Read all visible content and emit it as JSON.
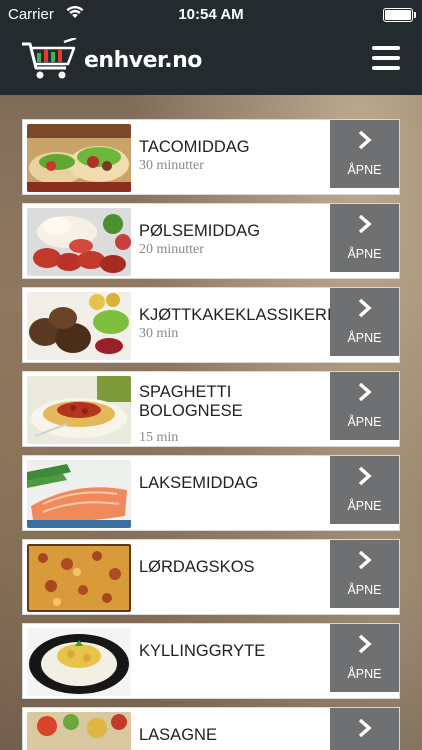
{
  "status_bar": {
    "carrier": "Carrier",
    "time": "10:54 AM"
  },
  "header": {
    "logo_text": "enhver.no",
    "accent_green": "#3cb54a",
    "accent_red": "#e53935"
  },
  "button_label": "ÅPNE",
  "recipes": [
    {
      "title": "TACOMIDDAG",
      "time": "30 minutter"
    },
    {
      "title": "PØLSEMIDDAG",
      "time": "20 minutter"
    },
    {
      "title": "KJØTTKAKEKLASSIKERI",
      "time": "30 min"
    },
    {
      "title": "SPAGHETTI BOLOGNESE",
      "time": "15 min"
    },
    {
      "title": "LAKSEMIDDAG",
      "time": ""
    },
    {
      "title": "LØRDAGSKOS",
      "time": ""
    },
    {
      "title": "KYLLINGGRYTE",
      "time": ""
    },
    {
      "title": "LASAGNE",
      "time": ""
    }
  ]
}
